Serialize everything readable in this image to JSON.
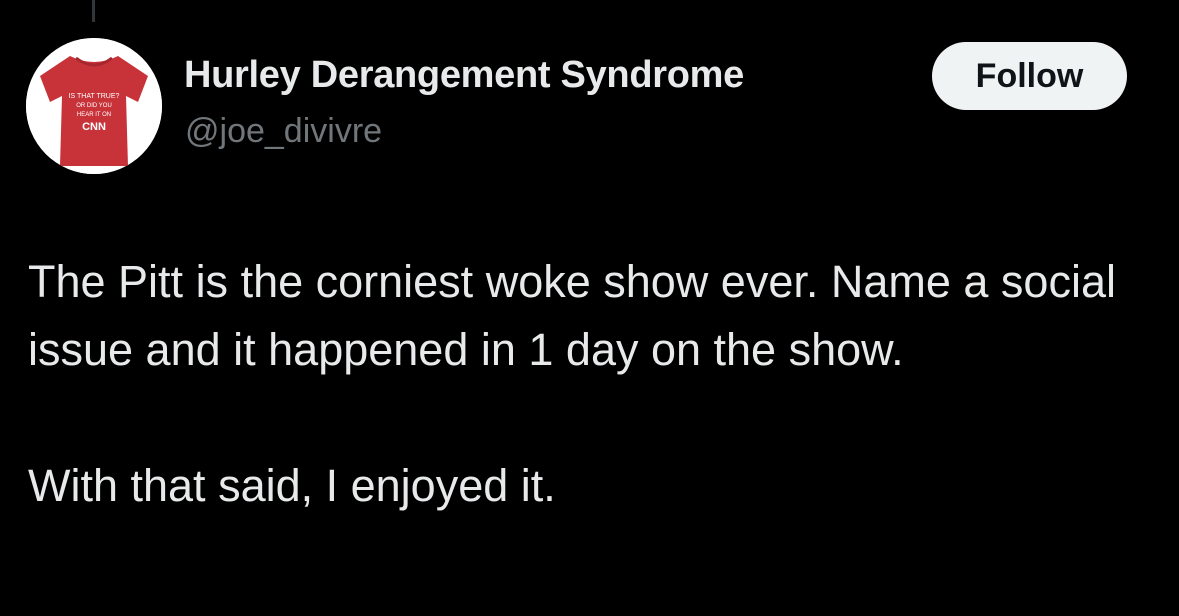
{
  "author": {
    "display_name": "Hurley Derangement Syndrome",
    "handle": "@joe_divivre",
    "avatar": {
      "icon": "red-tshirt-avatar",
      "shirt_lines": [
        "IS THAT TRUE?",
        "OR DID YOU",
        "HEAR IT ON",
        "CNN"
      ],
      "shirt_color": "#c8333a"
    }
  },
  "follow_button": {
    "label": "Follow"
  },
  "tweet": {
    "paragraphs": [
      "The Pitt is the corniest woke show ever. Name a social issue and it happened in 1 day on the show.",
      "With that said, I enjoyed it."
    ]
  },
  "colors": {
    "background": "#000000",
    "primary_text": "#e7e9ea",
    "secondary_text": "#71767b",
    "button_background": "#eff3f4",
    "button_text": "#0f1419"
  }
}
